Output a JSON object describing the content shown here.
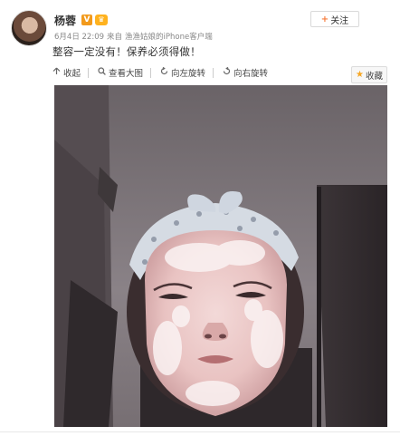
{
  "post": {
    "username": "杨蓉",
    "verified_badge": "V",
    "member_badge": "♛",
    "date": "6月4日 22:09",
    "source_prefix": "来自",
    "source": "渔渔姑娘的iPhone客户端",
    "text": "整容一定没有！保养必须得做！"
  },
  "actions": {
    "follow": {
      "icon": "+",
      "label": "关注"
    },
    "collapse": {
      "icon": "collapse-arrow-icon",
      "label": "收起"
    },
    "view_large": {
      "icon": "magnifier-icon",
      "label": "查看大图"
    },
    "rotate_left": {
      "icon": "rotate-left-icon",
      "label": "向左旋转"
    },
    "rotate_right": {
      "icon": "rotate-right-icon",
      "label": "向右旋转"
    },
    "collect": {
      "icon": "star-icon",
      "label": "收藏"
    }
  },
  "colors": {
    "accent_orange": "#f77c3d",
    "star_yellow": "#f6a623",
    "badge_orange": "#f29a1c"
  }
}
